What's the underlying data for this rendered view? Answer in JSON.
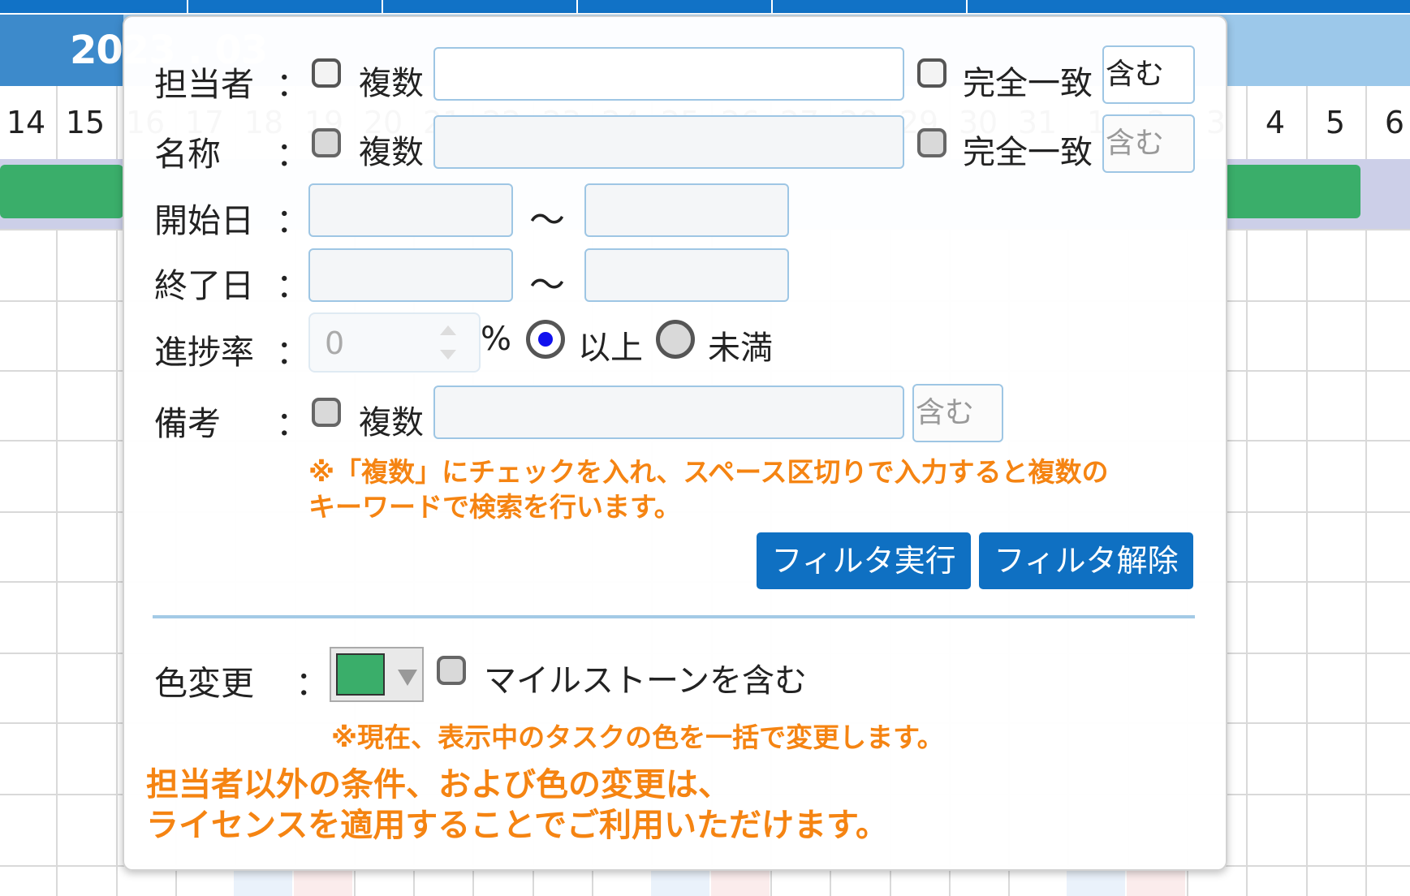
{
  "calendar": {
    "month_label": "2023 . 03",
    "days": [
      "14",
      "15",
      "16",
      "17",
      "18",
      "19",
      "20",
      "21",
      "22",
      "23",
      "24",
      "25",
      "26",
      "27",
      "28",
      "29",
      "30",
      "31",
      "1",
      "2",
      "3",
      "4",
      "5",
      "6"
    ]
  },
  "filter": {
    "assignee": {
      "label": "担当者",
      "multiple_label": "複数",
      "value": "",
      "exact_label": "完全一致",
      "match_mode": "含む"
    },
    "name": {
      "label": "名称",
      "multiple_label": "複数",
      "value": "",
      "exact_label": "完全一致",
      "match_mode": "含む"
    },
    "start_date": {
      "label": "開始日",
      "from": "",
      "to": "",
      "range_sep": "～"
    },
    "end_date": {
      "label": "終了日",
      "from": "",
      "to": "",
      "range_sep": "～"
    },
    "progress": {
      "label": "進捗率",
      "value": "0",
      "unit": "%",
      "option_gte": "以上",
      "option_lt": "未満",
      "selected": "以上"
    },
    "remarks": {
      "label": "備考",
      "multiple_label": "複数",
      "value": "",
      "match_mode": "含む"
    },
    "colon": "：",
    "note_line1": "※「複数」にチェックを入れ、スペース区切りで入力すると複数の",
    "note_line2": "キーワードで検索を行います。",
    "apply_button": "フィルタ実行",
    "clear_button": "フィルタ解除"
  },
  "color_change": {
    "label": "色変更",
    "selected_color": "#3aae6a",
    "milestone_label": "マイルストーンを含む",
    "note": "※現在、表示中のタスクの色を一括で変更します。"
  },
  "license_note": {
    "line1": "担当者以外の条件、および色の変更は、",
    "line2": "ライセンスを適用することでご利用いただけます。"
  },
  "colors": {
    "accent_blue": "#0f70c2",
    "note_orange": "#f58412",
    "task_green": "#3aae6a"
  }
}
